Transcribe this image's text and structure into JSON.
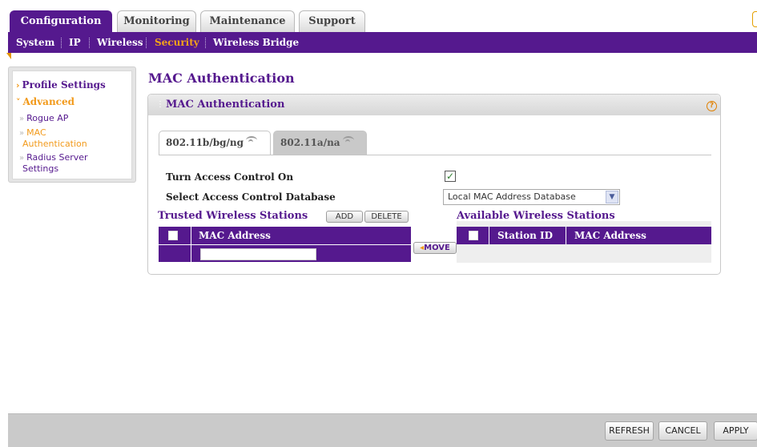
{
  "top_tabs": [
    {
      "label": "Configuration"
    },
    {
      "label": "Monitoring"
    },
    {
      "label": "Maintenance"
    },
    {
      "label": "Support"
    }
  ],
  "subnav": [
    {
      "label": "System"
    },
    {
      "label": "IP"
    },
    {
      "label": "Wireless"
    },
    {
      "label": "Security"
    },
    {
      "label": "Wireless Bridge"
    }
  ],
  "left_menu": {
    "profile_settings": "Profile Settings",
    "advanced": "Advanced",
    "rogue_ap": "Rogue AP",
    "mac_auth_line1": "MAC",
    "mac_auth_line2": "Authentication",
    "radius_line1": "Radius Server",
    "radius_line2": "Settings"
  },
  "page_title": "MAC Authentication",
  "panel": {
    "title": "MAC Authentication",
    "help_icon": "?",
    "tab_bg": "802.11b/bg/ng",
    "tab_a": "802.11a/na",
    "access_control_label": "Turn Access Control On",
    "access_control_checked": "✓",
    "database_label": "Select Access Control Database",
    "database_value": "Local MAC Address Database",
    "trusted_title": "Trusted Wireless Stations",
    "add_label": "ADD",
    "delete_label": "DELETE",
    "available_title": "Available Wireless Stations",
    "move_label": "MOVE",
    "trusted_col_mac": "MAC Address",
    "available_col_station": "Station ID",
    "available_col_mac": "MAC Address"
  },
  "footer": {
    "refresh": "REFRESH",
    "cancel": "CANCEL",
    "apply": "APPLY"
  },
  "colors": {
    "brand_purple": "#55198e",
    "accent_orange": "#f29a1b"
  }
}
